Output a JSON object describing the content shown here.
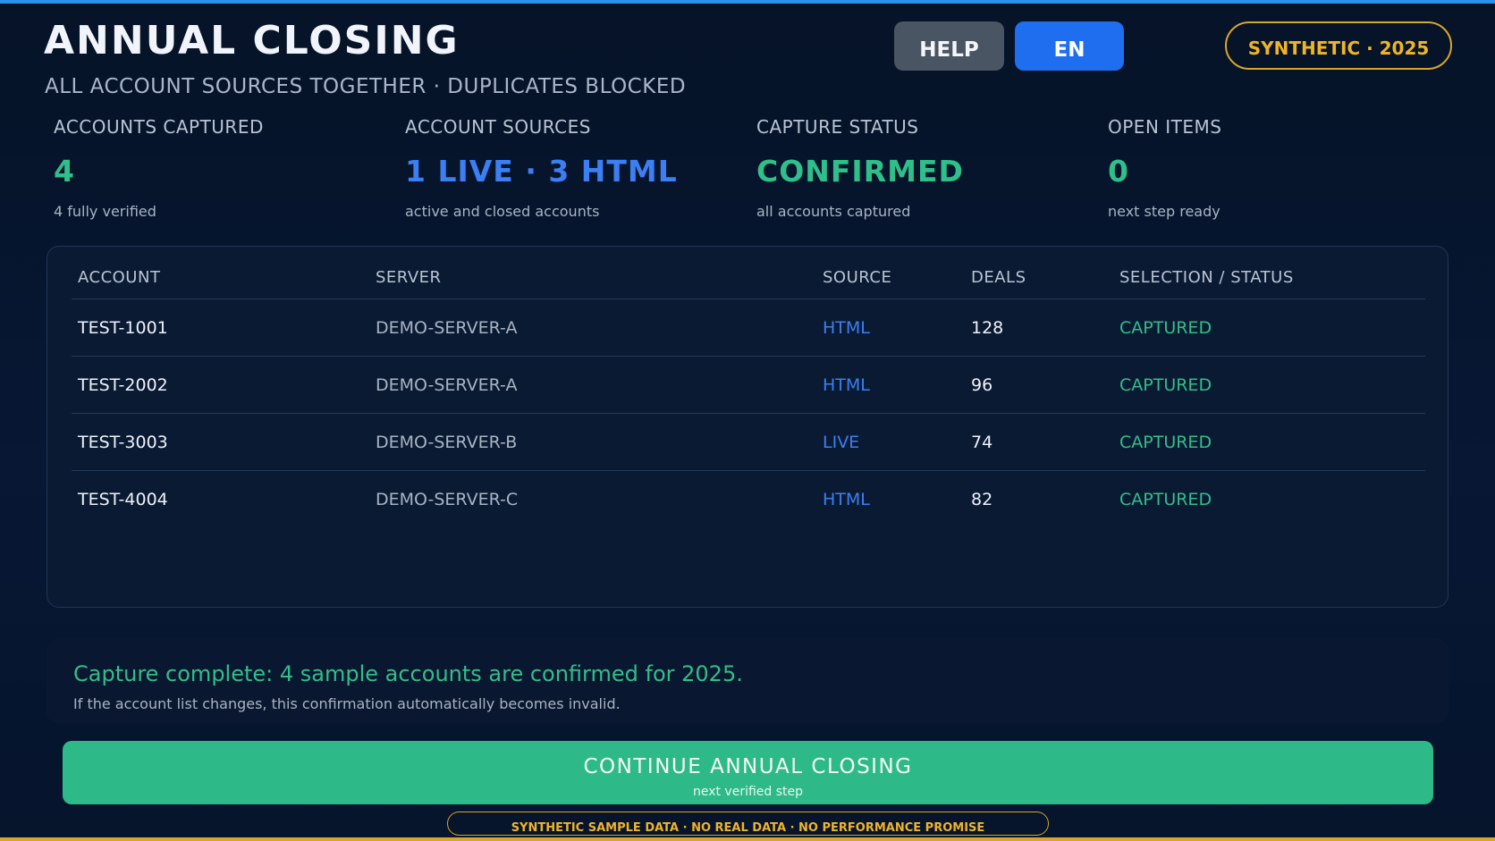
{
  "header": {
    "title": "ANNUAL CLOSING",
    "subtitle": "ALL ACCOUNT SOURCES TOGETHER · DUPLICATES BLOCKED",
    "help_label": "HELP",
    "language_label": "EN",
    "badge": "SYNTHETIC · 2025"
  },
  "kpis": [
    {
      "label": "ACCOUNTS CAPTURED",
      "value": "4",
      "sub": "4 fully verified"
    },
    {
      "label": "ACCOUNT SOURCES",
      "value": "1 LIVE · 3 HTML",
      "sub": "active and closed accounts"
    },
    {
      "label": "CAPTURE STATUS",
      "value": "CONFIRMED",
      "sub": "all accounts captured"
    },
    {
      "label": "OPEN ITEMS",
      "value": "0",
      "sub": "next step ready"
    }
  ],
  "table": {
    "columns": [
      "ACCOUNT",
      "SERVER",
      "SOURCE",
      "DEALS",
      "SELECTION / STATUS"
    ],
    "rows": [
      {
        "account": "TEST-1001",
        "server": "DEMO-SERVER-A",
        "source": "HTML",
        "deals": "128",
        "status": "CAPTURED"
      },
      {
        "account": "TEST-2002",
        "server": "DEMO-SERVER-A",
        "source": "HTML",
        "deals": "96",
        "status": "CAPTURED"
      },
      {
        "account": "TEST-3003",
        "server": "DEMO-SERVER-B",
        "source": "LIVE",
        "deals": "74",
        "status": "CAPTURED"
      },
      {
        "account": "TEST-4004",
        "server": "DEMO-SERVER-C",
        "source": "HTML",
        "deals": "82",
        "status": "CAPTURED"
      }
    ]
  },
  "notice": {
    "main": "Capture complete: 4 sample accounts are confirmed for 2025.",
    "sub": "If the account list changes, this confirmation automatically becomes invalid."
  },
  "action": {
    "label": "CONTINUE ANNUAL CLOSING",
    "sub": "next verified step"
  },
  "disclaimer": "SYNTHETIC SAMPLE DATA · NO REAL DATA · NO PERFORMANCE PROMISE",
  "colors": {
    "accent_green": "#2dba88",
    "accent_blue": "#1f6ef0",
    "warning_gold": "#d9a62a",
    "background": "#061327"
  }
}
